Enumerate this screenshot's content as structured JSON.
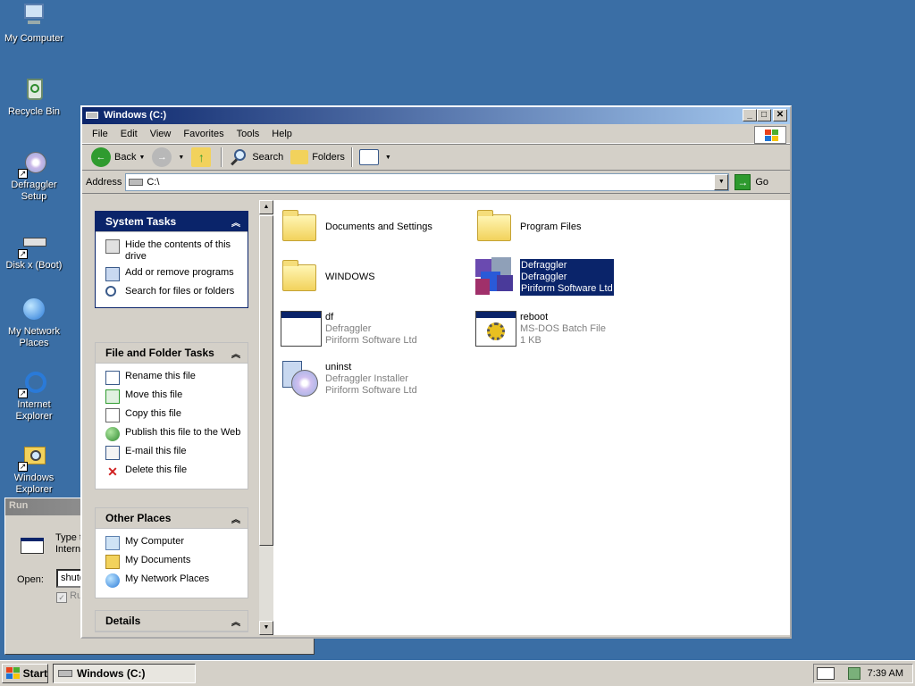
{
  "desktop": {
    "icons": [
      {
        "label": "My Computer"
      },
      {
        "label": "Recycle Bin"
      },
      {
        "label": "Defraggler Setup"
      },
      {
        "label": "Disk x (Boot)"
      },
      {
        "label": "My Network Places"
      },
      {
        "label": "Internet Explorer"
      },
      {
        "label": "Windows Explorer"
      }
    ]
  },
  "run_dialog": {
    "title": "Run",
    "text": "Type t Intern",
    "open_label": "Open:",
    "input_value": "shutd",
    "checkbox_label": "Ru"
  },
  "window": {
    "title": "Windows (C:)",
    "menu": [
      "File",
      "Edit",
      "View",
      "Favorites",
      "Tools",
      "Help"
    ],
    "toolbar": {
      "back": "Back",
      "search": "Search",
      "folders": "Folders"
    },
    "address": {
      "label": "Address",
      "value": "C:\\",
      "go": "Go"
    }
  },
  "taskpane": {
    "system_tasks": {
      "title": "System Tasks",
      "items": [
        "Hide the contents of this drive",
        "Add or remove programs",
        "Search for files or folders"
      ]
    },
    "file_folder_tasks": {
      "title": "File and Folder Tasks",
      "items": [
        "Rename this file",
        "Move this file",
        "Copy this file",
        "Publish this file to the Web",
        "E-mail this file",
        "Delete this file"
      ]
    },
    "other_places": {
      "title": "Other Places",
      "items": [
        "My Computer",
        "My Documents",
        "My Network Places"
      ]
    },
    "details": {
      "title": "Details"
    }
  },
  "files": [
    {
      "name": "Documents and Settings",
      "line2": "",
      "line3": "",
      "type": "folder"
    },
    {
      "name": "Program Files",
      "line2": "",
      "line3": "",
      "type": "folder"
    },
    {
      "name": "WINDOWS",
      "line2": "",
      "line3": "",
      "type": "folder"
    },
    {
      "name": "Defraggler",
      "line2": "Defraggler",
      "line3": "Piriform Software Ltd",
      "type": "app",
      "selected": true
    },
    {
      "name": "df",
      "line2": "Defraggler",
      "line3": "Piriform Software Ltd",
      "type": "exe"
    },
    {
      "name": "reboot",
      "line2": "MS-DOS Batch File",
      "line3": "1 KB",
      "type": "batch"
    },
    {
      "name": "uninst",
      "line2": "Defraggler Installer",
      "line3": "Piriform Software Ltd",
      "type": "installer"
    }
  ],
  "taskbar": {
    "start": "Start",
    "task": "Windows (C:)",
    "clock": "7:39 AM"
  },
  "colors": {
    "desktop": "#3a6ea5",
    "titlebar_start": "#0a246a",
    "titlebar_end": "#a6caf0",
    "selection": "#0a246a"
  }
}
